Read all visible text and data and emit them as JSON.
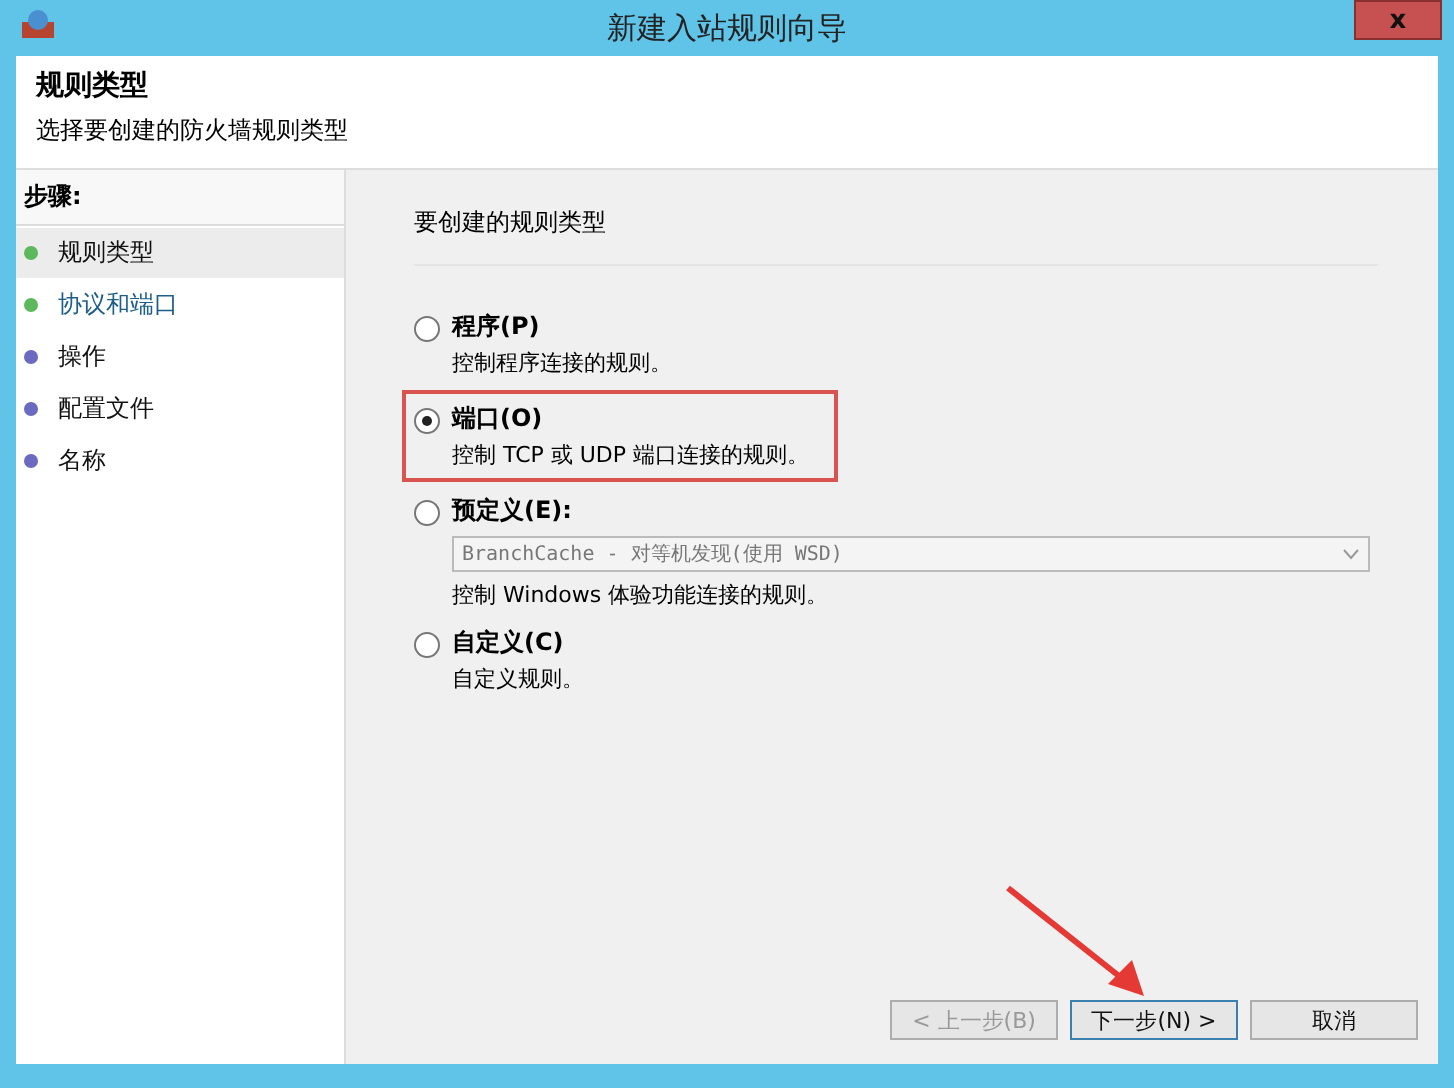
{
  "window": {
    "title": "新建入站规则向导",
    "close": "x"
  },
  "header": {
    "title": "规则类型",
    "subtitle": "选择要创建的防火墙规则类型"
  },
  "steps": {
    "heading": "步骤:",
    "items": [
      {
        "label": "规则类型",
        "selected": true,
        "linked": false,
        "color": "#5cb85c"
      },
      {
        "label": "协议和端口",
        "selected": false,
        "linked": true,
        "color": "#5cb85c"
      },
      {
        "label": "操作",
        "selected": false,
        "linked": false,
        "color": "#6a6ac0"
      },
      {
        "label": "配置文件",
        "selected": false,
        "linked": false,
        "color": "#6a6ac0"
      },
      {
        "label": "名称",
        "selected": false,
        "linked": false,
        "color": "#6a6ac0"
      }
    ]
  },
  "content": {
    "prompt": "要创建的规则类型",
    "options": [
      {
        "label": "程序(P)",
        "description": "控制程序连接的规则。",
        "selected": false,
        "highlighted": false
      },
      {
        "label": "端口(O)",
        "description": "控制 TCP 或 UDP 端口连接的规则。",
        "selected": true,
        "highlighted": true
      },
      {
        "label": "预定义(E):",
        "dropdown": {
          "value": "BranchCache - 对等机发现(使用 WSD)",
          "disabled": true
        },
        "description": "控制 Windows 体验功能连接的规则。",
        "selected": false,
        "highlighted": false
      },
      {
        "label": "自定义(C)",
        "description": "自定义规则。",
        "selected": false,
        "highlighted": false
      }
    ]
  },
  "buttons": [
    {
      "label": "< 上一步(B)",
      "disabled": true,
      "default": false
    },
    {
      "label": "下一步(N) >",
      "disabled": false,
      "default": true
    },
    {
      "label": "取消",
      "disabled": false,
      "default": false
    }
  ],
  "annotation_arrow": true
}
